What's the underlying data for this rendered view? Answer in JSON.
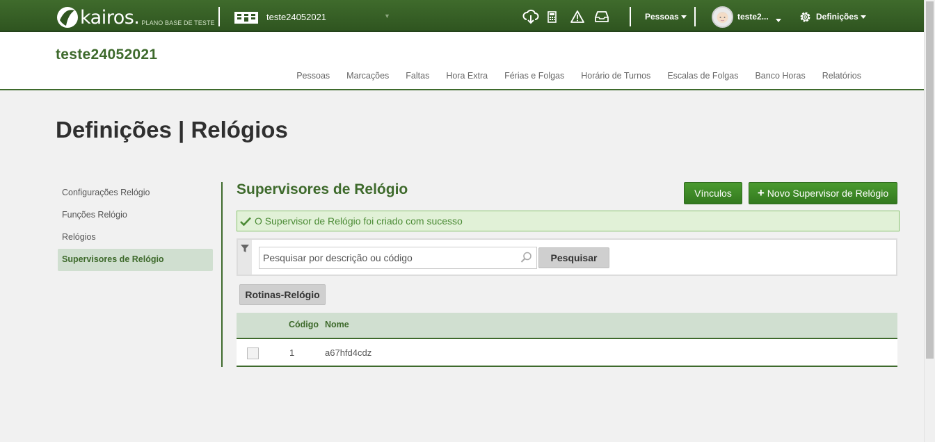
{
  "topbar": {
    "logo_text": "kairos.",
    "plan_text": "PLANO BASE DE TESTE",
    "company_name": "teste24052021",
    "pessoas_label": "Pessoas",
    "user_name": "teste2...",
    "settings_label": "Definições",
    "icons": [
      "cloud-download-icon",
      "calculator-icon",
      "warning-icon",
      "inbox-icon",
      "gear-icon"
    ]
  },
  "header": {
    "company_title": "teste24052021",
    "nav": [
      "Pessoas",
      "Marcações",
      "Faltas",
      "Hora Extra",
      "Férias e Folgas",
      "Horário de Turnos",
      "Escalas de Folgas",
      "Banco Horas",
      "Relatórios"
    ]
  },
  "page": {
    "title": "Definições | Relógios"
  },
  "sidenav": {
    "items": [
      "Configurações Relógio",
      "Funções Relógio",
      "Relógios",
      "Supervisores de Relógio"
    ],
    "active_index": 3
  },
  "content": {
    "section_title": "Supervisores de Relógio",
    "vinculos_label": "Vínculos",
    "new_button_label": "Novo Supervisor de Relógio",
    "alert_text": "O Supervisor de Relógio foi criado com sucesso",
    "search_placeholder": "Pesquisar por descrição ou código",
    "search_button": "Pesquisar",
    "rotinas_button": "Rotinas-Relógio",
    "table": {
      "headers": [
        "Código",
        "Nome"
      ],
      "rows": [
        {
          "codigo": "1",
          "nome": "a67hfd4cdz"
        }
      ]
    }
  },
  "colors": {
    "brand_green": "#3e6a2c",
    "button_green": "#3f8a28",
    "alert_bg": "#e1f1d7",
    "highlight": "#d0dfd0"
  }
}
